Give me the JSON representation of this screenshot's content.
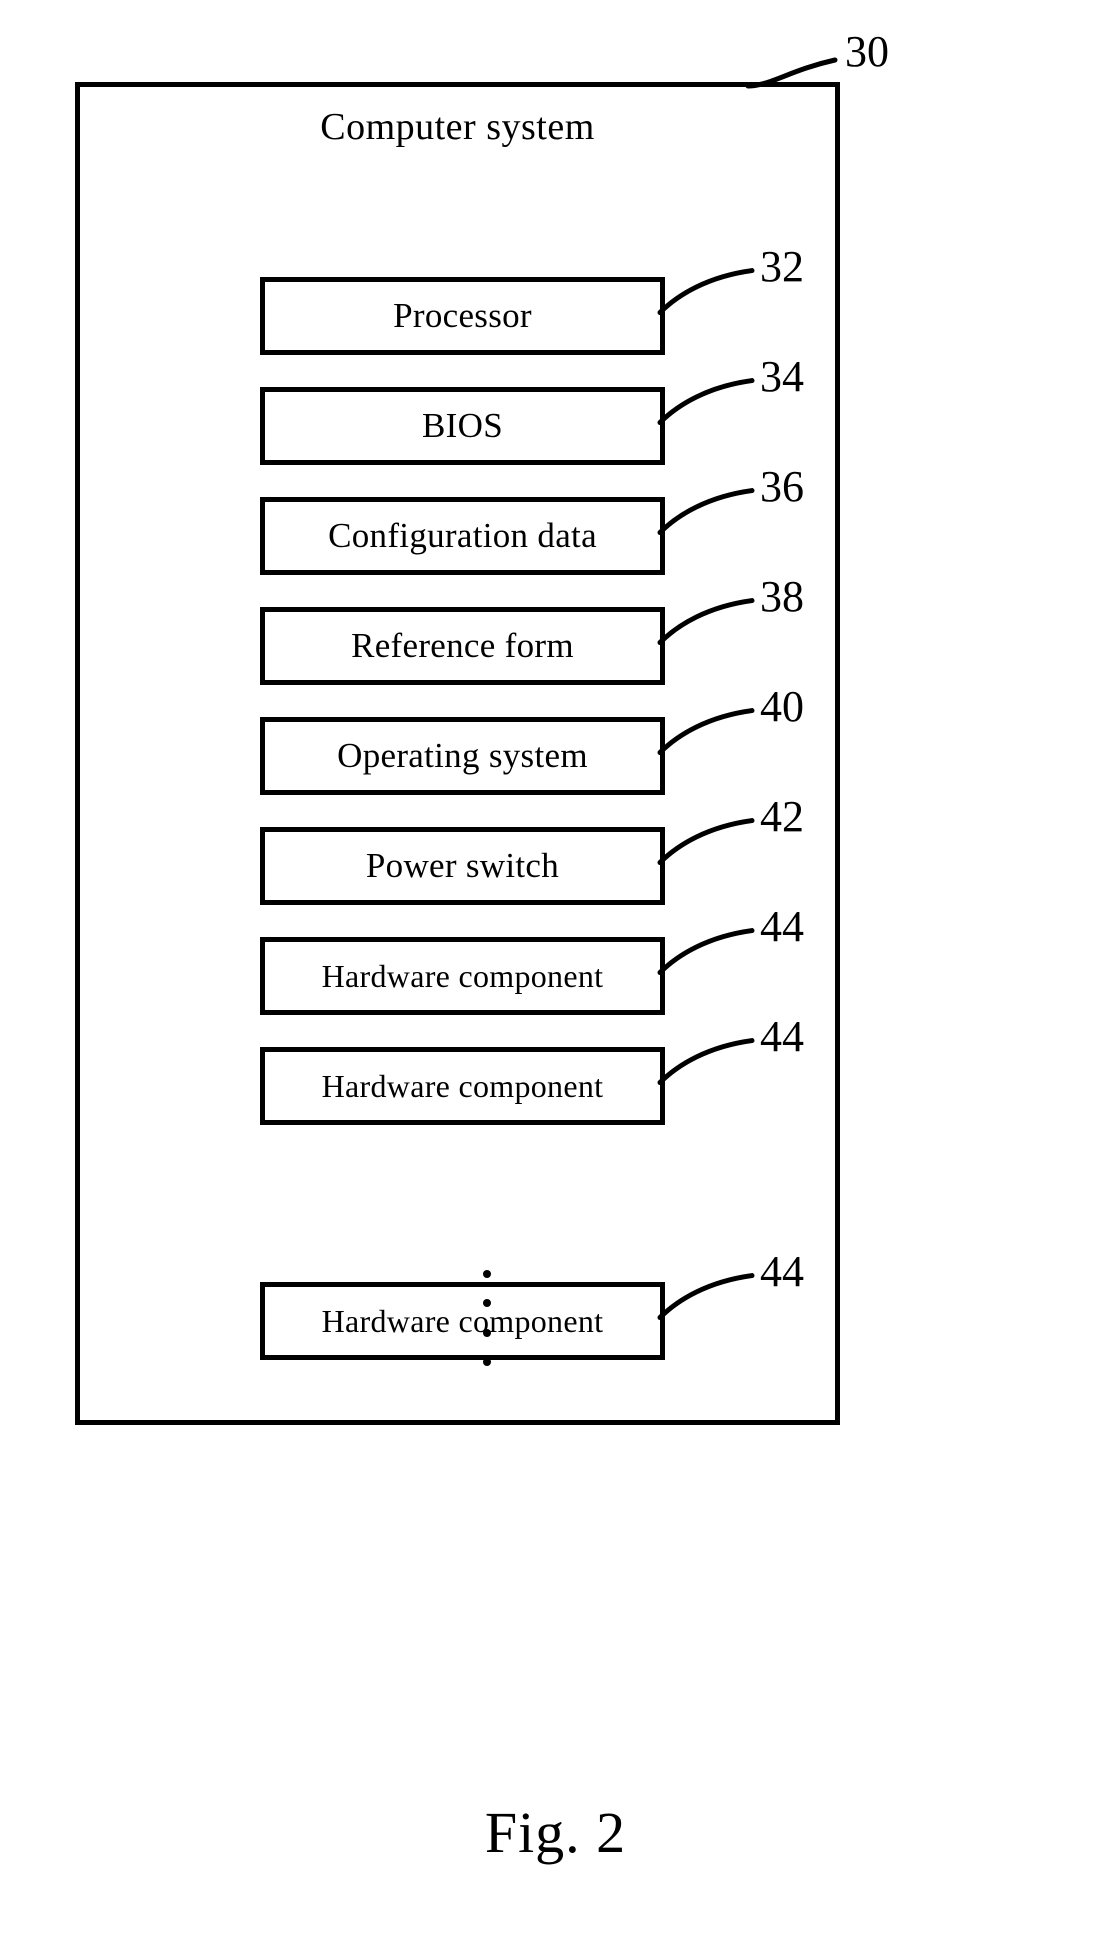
{
  "figure": {
    "caption": "Fig. 2",
    "system_label": "Computer system",
    "system_ref": "30"
  },
  "components": [
    {
      "label": "Processor",
      "ref": "32",
      "size": "normal"
    },
    {
      "label": "BIOS",
      "ref": "34",
      "size": "normal"
    },
    {
      "label": "Configuration data",
      "ref": "36",
      "size": "normal"
    },
    {
      "label": "Reference form",
      "ref": "38",
      "size": "normal"
    },
    {
      "label": "Operating system",
      "ref": "40",
      "size": "normal"
    },
    {
      "label": "Power switch",
      "ref": "42",
      "size": "normal"
    },
    {
      "label": "Hardware component",
      "ref": "44",
      "size": "small"
    },
    {
      "label": "Hardware component",
      "ref": "44",
      "size": "small"
    },
    {
      "label": "Hardware component",
      "ref": "44",
      "size": "small"
    }
  ],
  "ellipsis": {
    "symbol": "vertical-ellipsis",
    "dot_count": 4
  },
  "colors": {
    "stroke": "#000000",
    "background": "#ffffff"
  }
}
